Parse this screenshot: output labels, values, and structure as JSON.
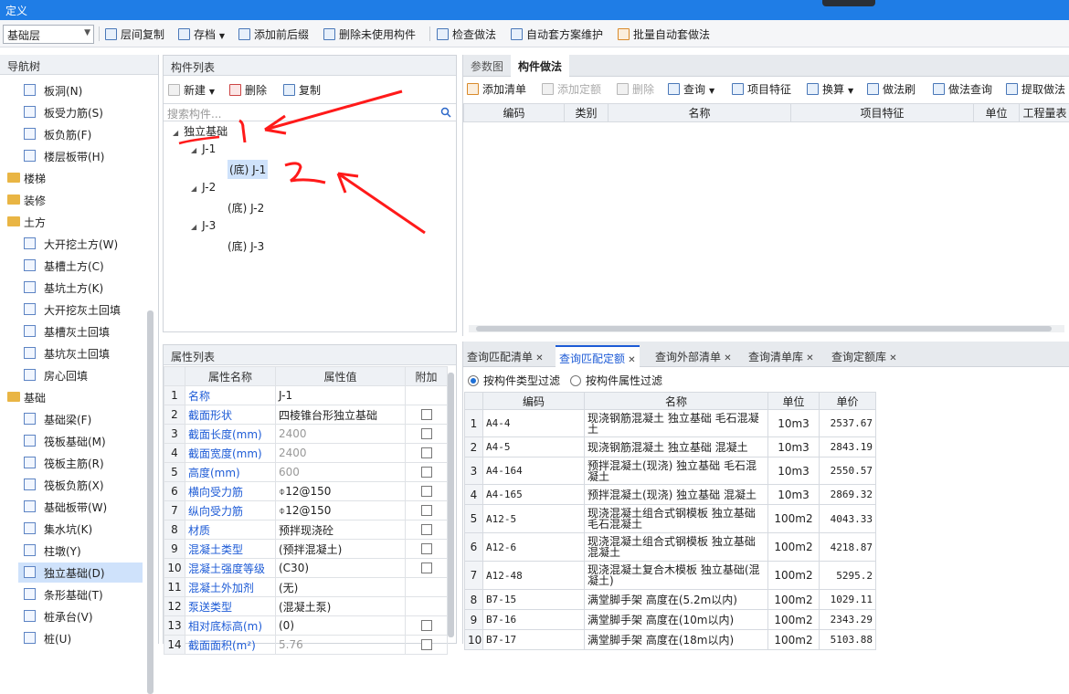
{
  "title": "定义",
  "floor": {
    "value": "基础层"
  },
  "toolbar": [
    {
      "label": "层间复制",
      "icon": "copy-icon"
    },
    {
      "label": "存档",
      "icon": "save-icon"
    },
    {
      "label": "添加前后缀",
      "icon": "affix-icon"
    },
    {
      "label": "删除未使用构件",
      "icon": "delete-unused-icon"
    },
    {
      "label": "检查做法",
      "icon": "check-icon"
    },
    {
      "label": "自动套方案维护",
      "icon": "scheme-icon"
    },
    {
      "label": "批量自动套做法",
      "icon": "batch-icon"
    }
  ],
  "nav": {
    "title": "导航树",
    "items": [
      {
        "label": "板洞(N)",
        "kind": "item"
      },
      {
        "label": "板受力筋(S)",
        "kind": "item"
      },
      {
        "label": "板负筋(F)",
        "kind": "item"
      },
      {
        "label": "楼层板带(H)",
        "kind": "item"
      },
      {
        "label": "楼梯",
        "kind": "folder"
      },
      {
        "label": "装修",
        "kind": "folder"
      },
      {
        "label": "土方",
        "kind": "folder-open"
      },
      {
        "label": "大开挖土方(W)",
        "kind": "item"
      },
      {
        "label": "基槽土方(C)",
        "kind": "item"
      },
      {
        "label": "基坑土方(K)",
        "kind": "item"
      },
      {
        "label": "大开挖灰土回填",
        "kind": "item"
      },
      {
        "label": "基槽灰土回填",
        "kind": "item"
      },
      {
        "label": "基坑灰土回填",
        "kind": "item"
      },
      {
        "label": "房心回填",
        "kind": "item"
      },
      {
        "label": "基础",
        "kind": "folder-open"
      },
      {
        "label": "基础梁(F)",
        "kind": "item"
      },
      {
        "label": "筏板基础(M)",
        "kind": "item"
      },
      {
        "label": "筏板主筋(R)",
        "kind": "item"
      },
      {
        "label": "筏板负筋(X)",
        "kind": "item"
      },
      {
        "label": "基础板带(W)",
        "kind": "item"
      },
      {
        "label": "集水坑(K)",
        "kind": "item"
      },
      {
        "label": "柱墩(Y)",
        "kind": "item"
      },
      {
        "label": "独立基础(D)",
        "kind": "item",
        "selected": true
      },
      {
        "label": "条形基础(T)",
        "kind": "item"
      },
      {
        "label": "桩承台(V)",
        "kind": "item"
      },
      {
        "label": "桩(U)",
        "kind": "item"
      }
    ]
  },
  "complist": {
    "title": "构件列表",
    "new_label": "新建",
    "delete_label": "删除",
    "copy_label": "复制",
    "search_placeholder": "搜索构件...",
    "tree": [
      {
        "label": "独立基础",
        "level": 0,
        "expanded": true
      },
      {
        "label": "J-1",
        "level": 1,
        "expanded": true
      },
      {
        "label": "(底) J-1",
        "level": 2,
        "selected": true
      },
      {
        "label": "J-2",
        "level": 1,
        "expanded": true
      },
      {
        "label": "(底) J-2",
        "level": 2
      },
      {
        "label": "J-3",
        "level": 1,
        "expanded": true
      },
      {
        "label": "(底) J-3",
        "level": 2
      }
    ]
  },
  "props": {
    "title": "属性列表",
    "headers": [
      "属性名称",
      "属性值",
      "附加"
    ],
    "rows": [
      {
        "n": "1",
        "name": "名称",
        "value": "J-1",
        "check": false,
        "gray": false
      },
      {
        "n": "2",
        "name": "截面形状",
        "value": "四棱锥台形独立基础",
        "check": true,
        "gray": false
      },
      {
        "n": "3",
        "name": "截面长度(mm)",
        "value": "2400",
        "check": true,
        "gray": true
      },
      {
        "n": "4",
        "name": "截面宽度(mm)",
        "value": "2400",
        "check": true,
        "gray": true
      },
      {
        "n": "5",
        "name": "高度(mm)",
        "value": "600",
        "check": true,
        "gray": true
      },
      {
        "n": "6",
        "name": "横向受力筋",
        "value": "⌽12@150",
        "check": true,
        "gray": false
      },
      {
        "n": "7",
        "name": "纵向受力筋",
        "value": "⌽12@150",
        "check": true,
        "gray": false
      },
      {
        "n": "8",
        "name": "材质",
        "value": "预拌现浇砼",
        "check": true,
        "gray": false
      },
      {
        "n": "9",
        "name": "混凝土类型",
        "value": "(预拌混凝土)",
        "check": true,
        "gray": false
      },
      {
        "n": "10",
        "name": "混凝土强度等级",
        "value": "(C30)",
        "check": true,
        "gray": false
      },
      {
        "n": "11",
        "name": "混凝土外加剂",
        "value": "(无)",
        "check": false,
        "gray": false
      },
      {
        "n": "12",
        "name": "泵送类型",
        "value": "(混凝土泵)",
        "check": false,
        "gray": false
      },
      {
        "n": "13",
        "name": "相对底标高(m)",
        "value": "(0)",
        "check": true,
        "gray": false
      },
      {
        "n": "14",
        "name": "截面面积(m²)",
        "value": "5.76",
        "check": true,
        "gray": true
      }
    ]
  },
  "method": {
    "tabs": [
      "参数图",
      "构件做法"
    ],
    "active_tab": 1,
    "tools": [
      {
        "label": "添加清单",
        "dis": false
      },
      {
        "label": "添加定额",
        "dis": true
      },
      {
        "label": "删除",
        "dis": true
      },
      {
        "label": "查询",
        "dis": false
      },
      {
        "label": "项目特征",
        "dis": false
      },
      {
        "label": "换算",
        "dis": false
      },
      {
        "label": "做法刷",
        "dis": false
      },
      {
        "label": "做法查询",
        "dis": false
      },
      {
        "label": "提取做法",
        "dis": false
      }
    ],
    "headers": [
      "编码",
      "类别",
      "名称",
      "项目特征",
      "单位",
      "工程量表"
    ]
  },
  "query": {
    "tabs": [
      "查询匹配清单",
      "查询匹配定额",
      "查询外部清单",
      "查询清单库",
      "查询定额库"
    ],
    "active_tab": 1,
    "filter_type": "按构件类型过滤",
    "filter_attr": "按构件属性过滤",
    "headers": [
      "编码",
      "名称",
      "单位",
      "单价"
    ],
    "rows": [
      {
        "n": "1",
        "code": "A4-4",
        "name": "现浇钢筋混凝土 独立基础 毛石混凝土",
        "unit": "10m3",
        "price": "2537.67",
        "h": 30
      },
      {
        "n": "2",
        "code": "A4-5",
        "name": "现浇钢筋混凝土 独立基础 混凝土",
        "unit": "10m3",
        "price": "2843.19",
        "h": 22
      },
      {
        "n": "3",
        "code": "A4-164",
        "name": "预拌混凝土(现浇) 独立基础 毛石混凝土",
        "unit": "10m3",
        "price": "2550.57",
        "h": 30
      },
      {
        "n": "4",
        "code": "A4-165",
        "name": "预拌混凝土(现浇) 独立基础 混凝土",
        "unit": "10m3",
        "price": "2869.32",
        "h": 22
      },
      {
        "n": "5",
        "code": "A12-5",
        "name": "现浇混凝土组合式钢模板 独立基础 毛石混凝土",
        "unit": "100m2",
        "price": "4043.33",
        "h": 31
      },
      {
        "n": "6",
        "code": "A12-6",
        "name": "现浇混凝土组合式钢模板 独立基础 混凝土",
        "unit": "100m2",
        "price": "4218.87",
        "h": 31
      },
      {
        "n": "7",
        "code": "A12-48",
        "name": "现浇混凝土复合木模板 独立基础(混凝土)",
        "unit": "100m2",
        "price": "5295.2",
        "h": 31
      },
      {
        "n": "8",
        "code": "B7-15",
        "name": "满堂脚手架 高度在(5.2m以内)",
        "unit": "100m2",
        "price": "1029.11",
        "h": 22
      },
      {
        "n": "9",
        "code": "B7-16",
        "name": "满堂脚手架 高度在(10m以内)",
        "unit": "100m2",
        "price": "2343.29",
        "h": 22
      },
      {
        "n": "10",
        "code": "B7-17",
        "name": "满堂脚手架 高度在(18m以内)",
        "unit": "100m2",
        "price": "5103.88",
        "h": 22
      }
    ]
  },
  "annotation_labels": {
    "one": "1",
    "two": "2"
  },
  "colors": {
    "title_bar": "#1f7de6",
    "accent": "#1d5bd6",
    "annotation": "#ff1a1a",
    "selection": "#cfe2fb"
  }
}
